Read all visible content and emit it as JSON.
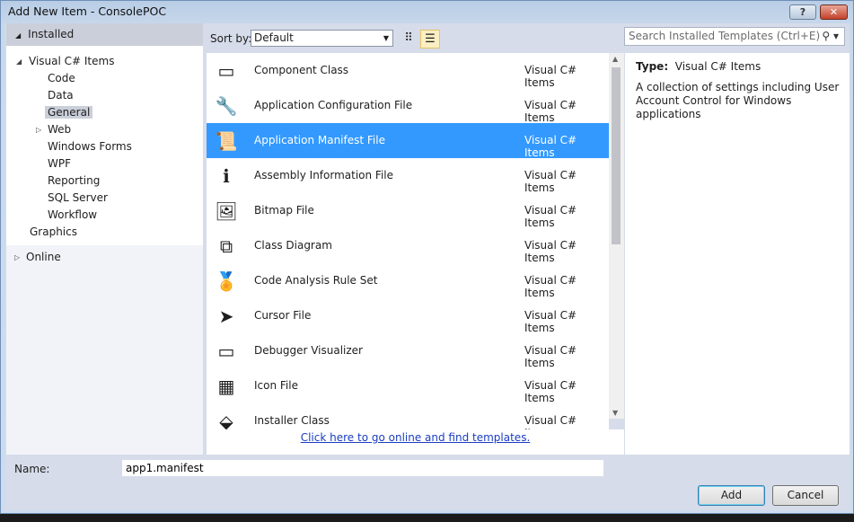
{
  "window": {
    "title": "Add New Item - ConsolePOC",
    "help": "?",
    "close": "✕"
  },
  "tree": {
    "header": "Installed",
    "root": "Visual C# Items",
    "children": [
      "Code",
      "Data",
      "General",
      "Web",
      "Windows Forms",
      "WPF",
      "Reporting",
      "SQL Server",
      "Workflow"
    ],
    "selected": "General",
    "graphics": "Graphics",
    "online": "Online"
  },
  "sort": {
    "label": "Sort by:",
    "value": "Default"
  },
  "search": {
    "placeholder": "Search Installed Templates (Ctrl+E)"
  },
  "items": [
    {
      "name": "Component Class",
      "type": "Visual C# Items",
      "icon": "component-class-icon"
    },
    {
      "name": "Application Configuration File",
      "type": "Visual C# Items",
      "icon": "config-file-icon"
    },
    {
      "name": "Application Manifest File",
      "type": "Visual C# Items",
      "icon": "manifest-file-icon",
      "selected": true
    },
    {
      "name": "Assembly Information File",
      "type": "Visual C# Items",
      "icon": "assembly-info-icon"
    },
    {
      "name": "Bitmap File",
      "type": "Visual C# Items",
      "icon": "bitmap-icon"
    },
    {
      "name": "Class Diagram",
      "type": "Visual C# Items",
      "icon": "class-diagram-icon"
    },
    {
      "name": "Code Analysis Rule Set",
      "type": "Visual C# Items",
      "icon": "rule-set-icon"
    },
    {
      "name": "Cursor File",
      "type": "Visual C# Items",
      "icon": "cursor-icon"
    },
    {
      "name": "Debugger Visualizer",
      "type": "Visual C# Items",
      "icon": "debugger-visualizer-icon"
    },
    {
      "name": "Icon File",
      "type": "Visual C# Items",
      "icon": "icon-file-icon"
    },
    {
      "name": "Installer Class",
      "type": "Visual C# Items",
      "icon": "installer-class-icon"
    }
  ],
  "online_link": "Click here to go online and find templates.",
  "details": {
    "type_label": "Type:",
    "type_value": "Visual C# Items",
    "description": "A collection of settings including User Account Control for Windows applications"
  },
  "name_field": {
    "label": "Name:",
    "value": "app1.manifest"
  },
  "buttons": {
    "add": "Add",
    "cancel": "Cancel"
  },
  "colors": {
    "selection": "#3399ff",
    "accent_link": "#1a3dc1"
  }
}
